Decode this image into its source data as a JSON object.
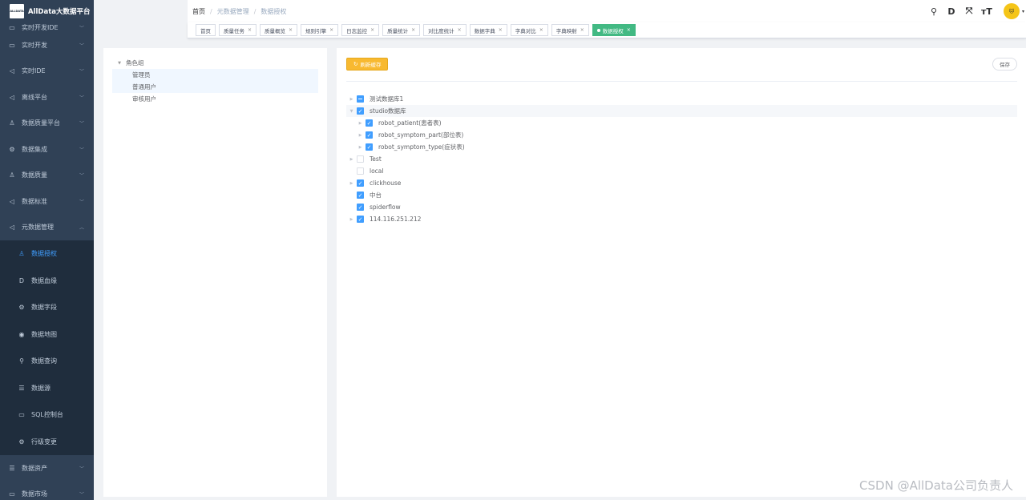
{
  "brand": {
    "logo_text": "ALLDATA",
    "title": "AllData大数据平台"
  },
  "sidebar": {
    "items_top": [
      {
        "label": "实时开发IDE",
        "icon": "▭"
      },
      {
        "label": "实时开发",
        "icon": "▭"
      },
      {
        "label": "实时IDE",
        "icon": "◁"
      },
      {
        "label": "离线平台",
        "icon": "◁"
      },
      {
        "label": "数据质量平台",
        "icon": "♙"
      },
      {
        "label": "数据集成",
        "icon": "⚙"
      },
      {
        "label": "数据质量",
        "icon": "♙"
      },
      {
        "label": "数据标准",
        "icon": "◁"
      },
      {
        "label": "元数据管理",
        "icon": "◁"
      }
    ],
    "sub_items": [
      {
        "label": "数据授权",
        "icon": "♙"
      },
      {
        "label": "数据血缘",
        "icon": "D"
      },
      {
        "label": "数据字段",
        "icon": "⚙"
      },
      {
        "label": "数据地图",
        "icon": "◉"
      },
      {
        "label": "数据查询",
        "icon": "⚲"
      },
      {
        "label": "数据源",
        "icon": "☰"
      },
      {
        "label": "SQL控制台",
        "icon": "▭"
      },
      {
        "label": "行级变更",
        "icon": "⚙"
      }
    ],
    "items_bottom": [
      {
        "label": "数据资产",
        "icon": "☰"
      },
      {
        "label": "数据市场",
        "icon": "▭"
      }
    ]
  },
  "breadcrumb": {
    "home": "首页",
    "parent": "元数据管理",
    "current": "数据授权"
  },
  "tools": {
    "search": "⚲",
    "doc": "D",
    "fullscreen": "⤧",
    "size": "тT",
    "avatar_caret": "▾"
  },
  "tags": [
    {
      "label": "首页",
      "closable": false
    },
    {
      "label": "质量任务",
      "closable": true
    },
    {
      "label": "质量概览",
      "closable": true
    },
    {
      "label": "规则引擎",
      "closable": true
    },
    {
      "label": "日志监控",
      "closable": true
    },
    {
      "label": "质量统计",
      "closable": true
    },
    {
      "label": "对比度统计",
      "closable": true
    },
    {
      "label": "数据字典",
      "closable": true
    },
    {
      "label": "字典对比",
      "closable": true
    },
    {
      "label": "字典映射",
      "closable": true
    },
    {
      "label": "数据授权",
      "closable": true,
      "active": true
    }
  ],
  "role_tree": {
    "root": "角色组",
    "children": [
      "管理员",
      "普通用户",
      "审核用户"
    ]
  },
  "actions": {
    "refresh": "刷新缓存",
    "save": "保存"
  },
  "db_tree": [
    {
      "label": "测试数据库1",
      "state": "indeterminate",
      "expandable": true,
      "level": 0
    },
    {
      "label": "studio数据库",
      "state": "checked",
      "expandable": true,
      "expanded": true,
      "level": 0
    },
    {
      "label": "robot_patient(患者表)",
      "state": "checked",
      "expandable": true,
      "level": 1
    },
    {
      "label": "robot_symptom_part(部位表)",
      "state": "checked",
      "expandable": true,
      "level": 1
    },
    {
      "label": "robot_symptom_type(症状表)",
      "state": "checked",
      "expandable": true,
      "level": 1
    },
    {
      "label": "Test",
      "state": "unchecked",
      "expandable": true,
      "level": 0
    },
    {
      "label": "local",
      "state": "unchecked",
      "expandable": false,
      "level": 0
    },
    {
      "label": "clickhouse",
      "state": "checked",
      "expandable": true,
      "level": 0
    },
    {
      "label": "中台",
      "state": "checked",
      "expandable": false,
      "level": 0
    },
    {
      "label": "spiderflow",
      "state": "checked",
      "expandable": false,
      "level": 0
    },
    {
      "label": "114.116.251.212",
      "state": "checked",
      "expandable": true,
      "level": 0
    }
  ],
  "watermark": "CSDN @AllData公司负责人",
  "colors": {
    "sidebar_bg": "#304156",
    "submenu_bg": "#1f2d3d",
    "active_tag": "#42b983",
    "primary": "#409eff",
    "warning": "#f8b930"
  }
}
